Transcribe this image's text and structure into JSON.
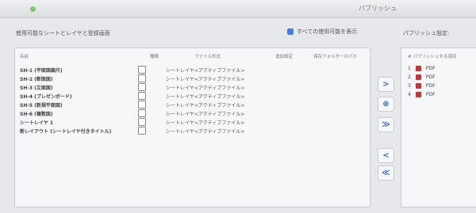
{
  "window": {
    "title": "パブリッシュ"
  },
  "left_section": {
    "title": "使用可能なシートとレイヤと登録画面"
  },
  "show_all": {
    "label": "すべての使用可能を表示"
  },
  "columns": {
    "name": "名前",
    "type": "種類",
    "file_format": "ファイル形式",
    "settings": "追加設定",
    "save_folder": "保存フォルダーのパス"
  },
  "rows": [
    {
      "name": "SH-1 (平面図縮尺)",
      "type": "シートレイヤ",
      "format": "<アクティブファイル>"
    },
    {
      "name": "SH-2 (断面図)",
      "type": "シートレイヤ",
      "format": "<アクティブファイル>"
    },
    {
      "name": "SH-3 (立面図)",
      "type": "シートレイヤ",
      "format": "<アクティブファイル>"
    },
    {
      "name": "SH-4 (プレゼンボード)",
      "type": "シートレイヤ",
      "format": "<アクティブファイル>"
    },
    {
      "name": "SH-5 (新規平面図)",
      "type": "シートレイヤ",
      "format": "<アクティブファイル>"
    },
    {
      "name": "SH-6 (複数図)",
      "type": "シートレイヤ",
      "format": "<アクティブファイル>"
    },
    {
      "name": "シートレイヤ 1",
      "type": "シートレイヤ",
      "format": "<アクティブファイル>"
    },
    {
      "name": "新レイアウト (シートレイヤ付きタイトル)",
      "type": "シートレイヤ",
      "format": "<アクティブファイル>"
    }
  ],
  "arrow_buttons": [
    ">",
    "⊕",
    "≫",
    "<",
    "≪"
  ],
  "right_section": {
    "title": "パブリッシュ設定:",
    "head": "# パブリッシュする項目",
    "items": [
      {
        "num": "1",
        "format": "PDF"
      },
      {
        "num": "2",
        "format": "PDF"
      },
      {
        "num": "3",
        "format": "PDF"
      },
      {
        "num": "4",
        "format": "PDF"
      }
    ]
  }
}
